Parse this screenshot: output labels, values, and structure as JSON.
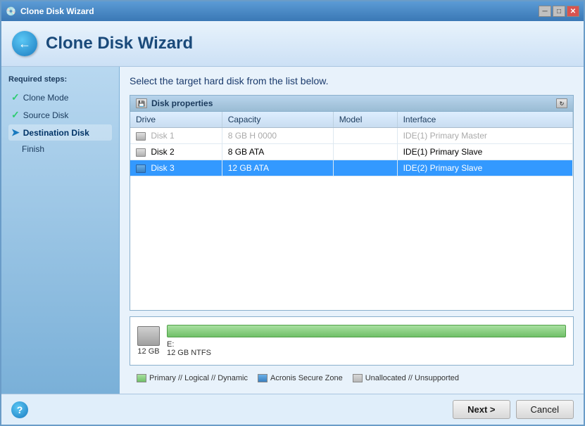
{
  "window": {
    "title": "Clone Disk Wizard",
    "title_icon": "💿"
  },
  "header": {
    "title": "Clone Disk Wizard"
  },
  "sidebar": {
    "section_label": "Required steps:",
    "items": [
      {
        "id": "clone-mode",
        "label": "Clone Mode",
        "status": "checked"
      },
      {
        "id": "source-disk",
        "label": "Source Disk",
        "status": "checked"
      },
      {
        "id": "destination-disk",
        "label": "Destination Disk",
        "status": "active"
      },
      {
        "id": "finish",
        "label": "Finish",
        "status": "none"
      }
    ]
  },
  "content": {
    "instruction": "Select the target hard disk from the list below.",
    "disk_properties_label": "Disk properties",
    "table": {
      "columns": [
        "Drive",
        "Capacity",
        "Model",
        "Interface"
      ],
      "rows": [
        {
          "id": "disk1",
          "drive": "Disk 1",
          "capacity": "8 GB H 0000",
          "model": "",
          "interface": "IDE(1) Primary Master",
          "disabled": true
        },
        {
          "id": "disk2",
          "drive": "Disk 2",
          "capacity": "8 GB ATA",
          "model": "",
          "interface": "IDE(1) Primary Slave",
          "disabled": false,
          "selected": false
        },
        {
          "id": "disk3",
          "drive": "Disk 3",
          "capacity": "12 GB ATA",
          "model": "",
          "interface": "IDE(2) Primary Slave",
          "disabled": false,
          "selected": true
        }
      ]
    }
  },
  "bottom_panel": {
    "size_label": "12 GB",
    "partition_label": "E:",
    "partition_detail": "12 GB  NTFS"
  },
  "legend": {
    "items": [
      {
        "id": "primary",
        "label": "Primary // Logical // Dynamic",
        "color": "green"
      },
      {
        "id": "acronis",
        "label": "Acronis Secure Zone",
        "color": "blue"
      },
      {
        "id": "unallocated",
        "label": "Unallocated // Unsupported",
        "color": "gray"
      }
    ]
  },
  "footer": {
    "next_label": "Next >",
    "cancel_label": "Cancel"
  }
}
